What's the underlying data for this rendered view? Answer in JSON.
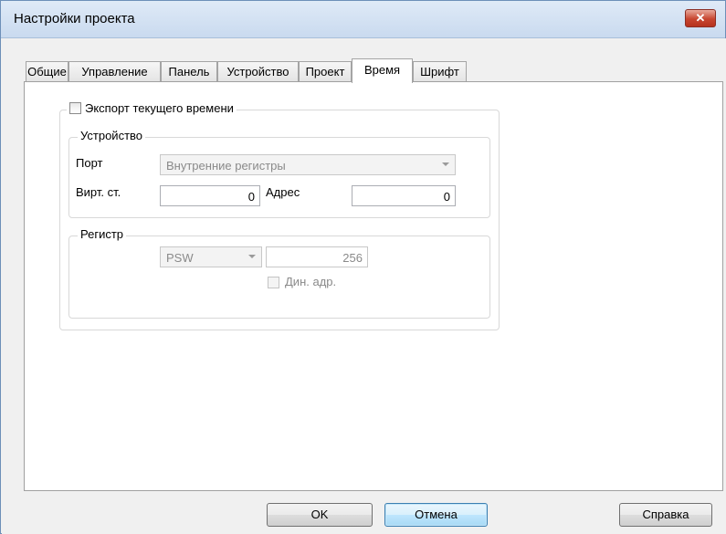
{
  "window": {
    "title": "Настройки проекта",
    "close_glyph": "✕"
  },
  "tabs": [
    {
      "label": "Общие"
    },
    {
      "label": "Управление"
    },
    {
      "label": "Панель"
    },
    {
      "label": "Устройство"
    },
    {
      "label": "Проект"
    },
    {
      "label": "Время",
      "selected": true
    },
    {
      "label": "Шрифт"
    }
  ],
  "time_tab": {
    "export_checkbox": {
      "label": "Экспорт текущего времени",
      "checked": false
    },
    "device_group": {
      "legend": "Устройство",
      "port_label": "Порт",
      "port_value": "Внутренние регистры",
      "virt_station_label": "Вирт. ст.",
      "virt_station_value": "0",
      "address_label": "Адрес",
      "address_value": "0"
    },
    "register_group": {
      "legend": "Регистр",
      "register_type": "PSW",
      "register_address": "256",
      "dyn_addr_label": "Дин. адр.",
      "dyn_addr_checked": false
    }
  },
  "buttons": {
    "ok": "OK",
    "cancel": "Отмена",
    "help": "Справка"
  },
  "colors": {
    "accent_blue": "#3c7fb1",
    "close_red": "#c7452f"
  }
}
